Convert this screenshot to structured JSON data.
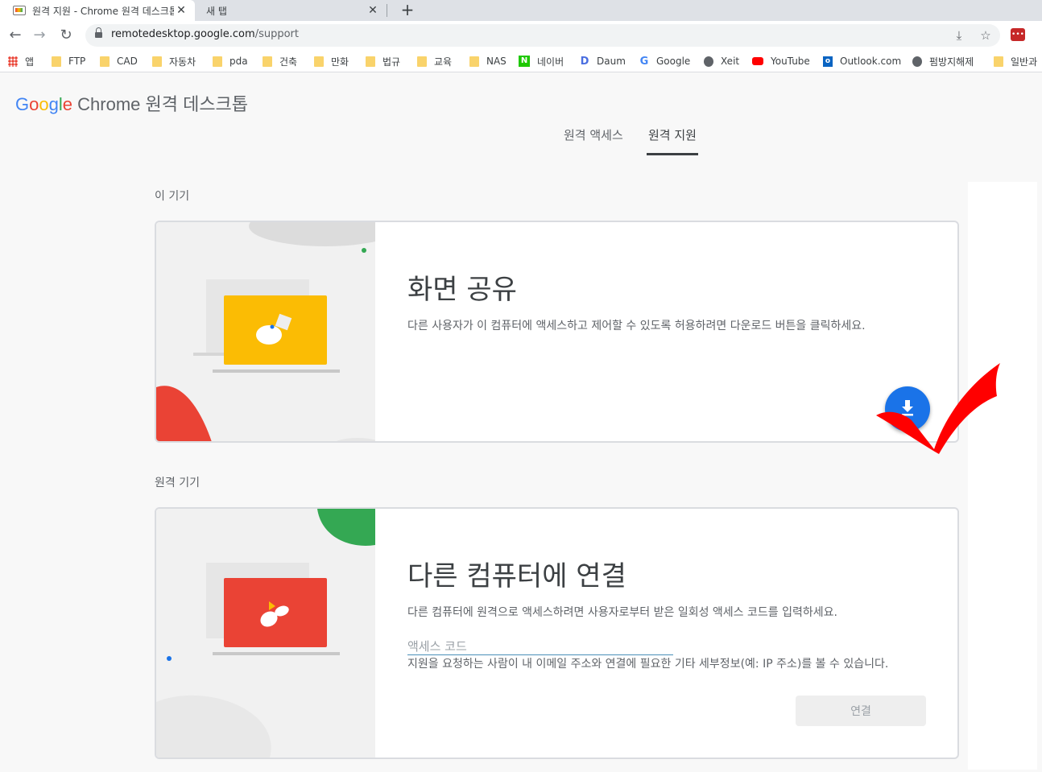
{
  "browser": {
    "tabs": [
      {
        "title": "원격 지원 - Chrome 원격 데스크톱",
        "close": "✕"
      },
      {
        "title": "새 탭",
        "close": "✕"
      }
    ],
    "new_tab": "+",
    "url_host": "remotedesktop.google.com",
    "url_path": "/support",
    "nav": {
      "back": "←",
      "forward": "→",
      "reload": "↻"
    },
    "omni_icons": {
      "install": "⤓",
      "star": "☆"
    },
    "extension_badge": "•••"
  },
  "bookmarks": [
    {
      "label": "앱",
      "icon": "apps-icon"
    },
    {
      "label": "FTP",
      "icon": "folder-icon"
    },
    {
      "label": "CAD",
      "icon": "folder-icon"
    },
    {
      "label": "자동차",
      "icon": "folder-icon"
    },
    {
      "label": "pda",
      "icon": "folder-icon"
    },
    {
      "label": "건축",
      "icon": "folder-icon"
    },
    {
      "label": "만화",
      "icon": "folder-icon"
    },
    {
      "label": "법규",
      "icon": "folder-icon"
    },
    {
      "label": "교육",
      "icon": "folder-icon"
    },
    {
      "label": "NAS",
      "icon": "folder-icon"
    },
    {
      "label": "네이버",
      "icon": "naver-icon",
      "glyph": "N"
    },
    {
      "label": "Daum",
      "icon": "daum-icon",
      "glyph": "D"
    },
    {
      "label": "Google",
      "icon": "google-icon",
      "glyph": "G"
    },
    {
      "label": "Xeit",
      "icon": "globe-icon"
    },
    {
      "label": "YouTube",
      "icon": "youtube-icon"
    },
    {
      "label": "Outlook.com",
      "icon": "outlook-icon",
      "glyph": "o"
    },
    {
      "label": "펌방지해제",
      "icon": "globe-icon"
    },
    {
      "label": "일반과",
      "icon": "folder-icon"
    }
  ],
  "page": {
    "logo": {
      "g": "G",
      "o1": "o",
      "o2": "o",
      "g2": "g",
      "l": "l",
      "e": "e",
      "product": " Chrome 원격 데스크톱"
    },
    "tabs": [
      {
        "label": "원격 액세스"
      },
      {
        "label": "원격 지원",
        "active": true
      }
    ],
    "this_device_label": "이 기기",
    "share_card": {
      "title": "화면 공유",
      "description": "다른 사용자가 이 컴퓨터에 액세스하고 제어할 수 있도록 허용하려면 다운로드 버튼을 클릭하세요.",
      "fab_icon": "download-icon"
    },
    "remote_device_label": "원격 기기",
    "connect_card": {
      "title": "다른 컴퓨터에 연결",
      "description": "다른 컴퓨터에 원격으로 액세스하려면 사용자로부터 받은 일회성 액세스 코드를 입력하세요.",
      "input_placeholder": "액세스 코드",
      "input_value": "",
      "hint": "지원을 요청하는 사람이 내 이메일 주소와 연결에 필요한 기타 세부정보(예: IP 주소)를 볼 수 있습니다.",
      "connect_label": "연결"
    }
  },
  "colors": {
    "accent_blue": "#1a73e8",
    "yellow": "#fbbc04",
    "red": "#ea4335",
    "green": "#34a853",
    "check_red": "#ff0000"
  }
}
